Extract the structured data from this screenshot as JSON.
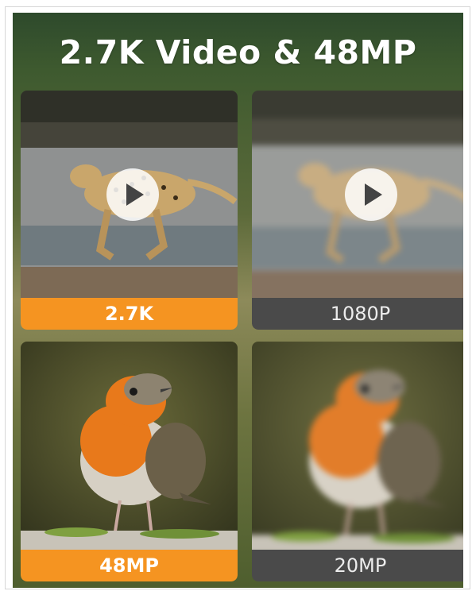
{
  "banner": {
    "title": "2.7K Video & 48MP"
  },
  "cards": [
    {
      "label": "2.7K",
      "kind": "video",
      "style": "highlight",
      "subject": "cheetah",
      "icon": "play-icon"
    },
    {
      "label": "1080P",
      "kind": "video",
      "style": "muted",
      "subject": "cheetah",
      "icon": "play-icon"
    },
    {
      "label": "48MP",
      "kind": "photo",
      "style": "highlight",
      "subject": "robin"
    },
    {
      "label": "20MP",
      "kind": "photo",
      "style": "muted",
      "subject": "robin"
    }
  ],
  "colors": {
    "highlight": "#f59421",
    "muted": "#4a4a4a",
    "title": "#ffffff"
  }
}
